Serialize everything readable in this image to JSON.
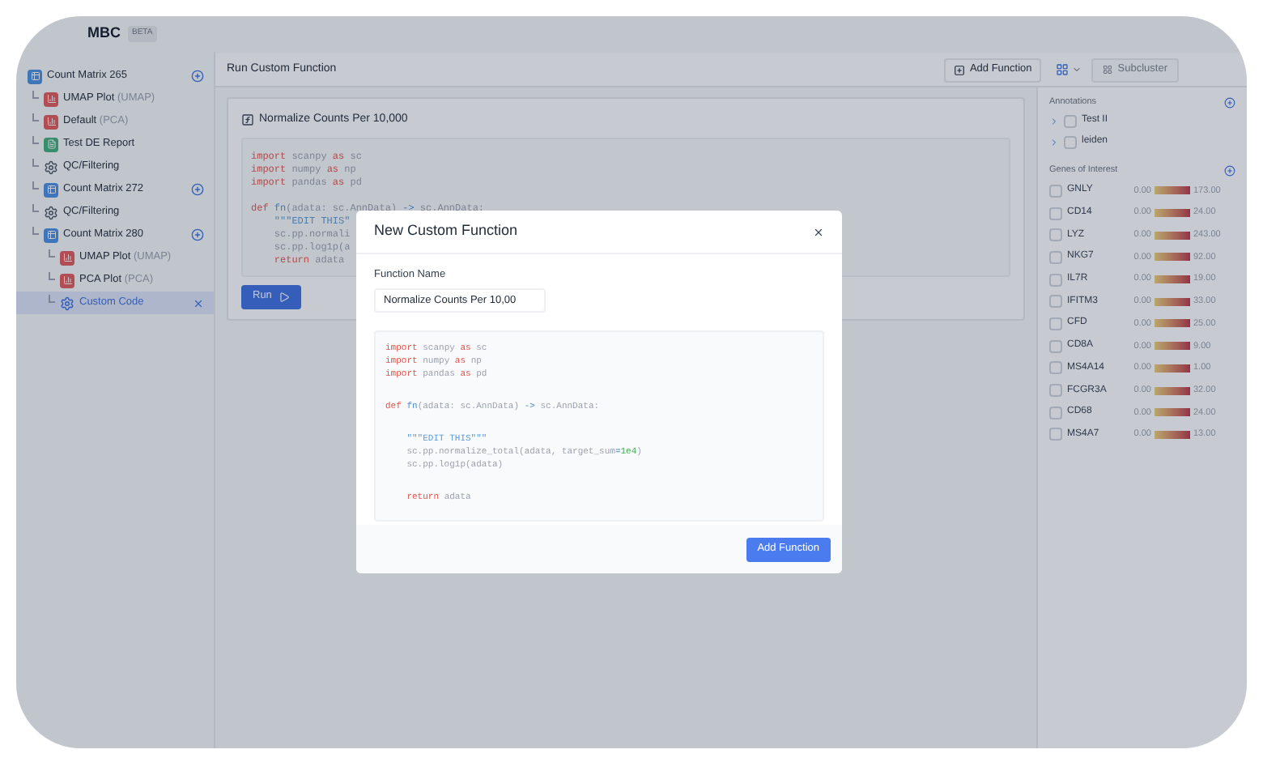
{
  "app": {
    "name": "MBC",
    "badge": "BETA"
  },
  "sidebar": {
    "tree": [
      {
        "kind": "matrix",
        "label": "Count Matrix 265",
        "selected": false,
        "children": [
          {
            "kind": "plot",
            "label": "UMAP Plot",
            "detail": "(UMAP)",
            "selected": false
          },
          {
            "kind": "plot",
            "label": "Default",
            "detail": "(PCA)",
            "selected": false
          },
          {
            "kind": "report",
            "label": "Test DE Report",
            "selected": false
          },
          {
            "kind": "step",
            "label": "QC/Filtering",
            "selected": false
          },
          {
            "kind": "matrix",
            "label": "Count Matrix 272",
            "selected": false
          },
          {
            "kind": "step",
            "label": "QC/Filtering",
            "selected": false
          },
          {
            "kind": "matrix",
            "label": "Count Matrix 280",
            "selected": false,
            "children": [
              {
                "kind": "plot",
                "label": "UMAP Plot",
                "detail": "(UMAP)",
                "selected": false
              },
              {
                "kind": "plot",
                "label": "PCA Plot",
                "detail": "(PCA)",
                "selected": false
              },
              {
                "kind": "code",
                "label": "Custom Code",
                "selected": true
              }
            ]
          }
        ]
      }
    ]
  },
  "toolbar": {
    "title": "Run Custom Function",
    "add_button": "Add Function",
    "subcluster_button": {
      "label": "Subcluster",
      "disabled": true
    }
  },
  "function_card": {
    "title": "Normalize Counts Per 10,000",
    "run_button": "Run",
    "code": [
      [
        [
          {
            "kind": "kw",
            "text": "import"
          },
          {
            "kind": "plain",
            "text": " scanpy "
          },
          {
            "kind": "kw",
            "text": "as"
          },
          {
            "kind": "plain",
            "text": " sc"
          }
        ],
        [
          {
            "kind": "kw",
            "text": "import"
          },
          {
            "kind": "plain",
            "text": " numpy "
          },
          {
            "kind": "kw",
            "text": "as"
          },
          {
            "kind": "plain",
            "text": " np"
          }
        ],
        [
          {
            "kind": "kw",
            "text": "import"
          },
          {
            "kind": "plain",
            "text": " pandas "
          },
          {
            "kind": "kw",
            "text": "as"
          },
          {
            "kind": "plain",
            "text": " pd"
          }
        ]
      ],
      [
        [
          {
            "kind": "kw",
            "text": "def "
          },
          {
            "kind": "fn",
            "text": "fn"
          },
          {
            "kind": "plain",
            "text": "(adata: sc.AnnData) "
          },
          {
            "kind": "op",
            "text": "->"
          },
          {
            "kind": "plain",
            "text": " sc.AnnData:"
          }
        ],
        [
          {
            "kind": "str",
            "text": "    \"\"\"EDIT THIS\""
          }
        ],
        [
          {
            "kind": "plain",
            "text": "    sc.pp.normali"
          }
        ],
        [
          {
            "kind": "plain",
            "text": "    sc.pp.log1p(a"
          }
        ],
        [
          {
            "kind": "kw",
            "text": "    return"
          },
          {
            "kind": "plain",
            "text": " adata"
          }
        ]
      ]
    ]
  },
  "annotations": {
    "title": "Annotations",
    "items": [
      {
        "label": "Test II",
        "expanded": false,
        "checked": false
      },
      {
        "label": "leiden",
        "expanded": false,
        "checked": false
      }
    ]
  },
  "genes": {
    "title": "Genes of Interest",
    "items": [
      {
        "name": "GNLY",
        "min": "0.00",
        "max": "173.00",
        "checked": false
      },
      {
        "name": "CD14",
        "min": "0.00",
        "max": "24.00",
        "checked": false
      },
      {
        "name": "LYZ",
        "min": "0.00",
        "max": "243.00",
        "checked": false
      },
      {
        "name": "NKG7",
        "min": "0.00",
        "max": "92.00",
        "checked": false
      },
      {
        "name": "IL7R",
        "min": "0.00",
        "max": "19.00",
        "checked": false
      },
      {
        "name": "IFITM3",
        "min": "0.00",
        "max": "33.00",
        "checked": false
      },
      {
        "name": "CFD",
        "min": "0.00",
        "max": "25.00",
        "checked": false
      },
      {
        "name": "CD8A",
        "min": "0.00",
        "max": "9.00",
        "checked": false
      },
      {
        "name": "MS4A14",
        "min": "0.00",
        "max": "1.00",
        "checked": false
      },
      {
        "name": "FCGR3A",
        "min": "0.00",
        "max": "32.00",
        "checked": false
      },
      {
        "name": "CD68",
        "min": "0.00",
        "max": "24.00",
        "checked": false
      },
      {
        "name": "MS4A7",
        "min": "0.00",
        "max": "13.00",
        "checked": false
      }
    ]
  },
  "modal": {
    "title": "New Custom Function",
    "field_label": "Function Name",
    "field_value": "Normalize Counts Per 10,00",
    "submit": "Add Function",
    "code": [
      [
        [
          {
            "kind": "kw",
            "text": "import"
          },
          {
            "kind": "plain",
            "text": " scanpy "
          },
          {
            "kind": "kw",
            "text": "as"
          },
          {
            "kind": "plain",
            "text": " sc"
          }
        ],
        [
          {
            "kind": "kw",
            "text": "import"
          },
          {
            "kind": "plain",
            "text": " numpy "
          },
          {
            "kind": "kw",
            "text": "as"
          },
          {
            "kind": "plain",
            "text": " np"
          }
        ],
        [
          {
            "kind": "kw",
            "text": "import"
          },
          {
            "kind": "plain",
            "text": " pandas "
          },
          {
            "kind": "kw",
            "text": "as"
          },
          {
            "kind": "plain",
            "text": " pd"
          }
        ]
      ],
      [
        [
          {
            "kind": "kw",
            "text": "def "
          },
          {
            "kind": "fn",
            "text": "fn"
          },
          {
            "kind": "plain",
            "text": "(adata: sc.AnnData) "
          },
          {
            "kind": "op",
            "text": "->"
          },
          {
            "kind": "plain",
            "text": " sc.AnnData:"
          }
        ]
      ],
      [
        [
          {
            "kind": "str",
            "text": "    \"\"\"EDIT THIS\"\"\""
          }
        ],
        [
          {
            "kind": "plain",
            "text": "    sc.pp.normalize_total(adata, target_sum"
          },
          {
            "kind": "op",
            "text": "="
          },
          {
            "kind": "num",
            "text": "1e4"
          },
          {
            "kind": "plain",
            "text": ")"
          }
        ],
        [
          {
            "kind": "plain",
            "text": "    sc.pp.log1p(adata)"
          }
        ]
      ],
      [
        [
          {
            "kind": "kw",
            "text": "    return"
          },
          {
            "kind": "plain",
            "text": " adata"
          }
        ]
      ]
    ]
  }
}
